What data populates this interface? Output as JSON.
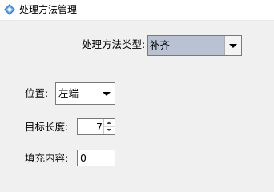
{
  "window": {
    "title": "处理方法管理",
    "icon": "diamond-app-icon"
  },
  "form": {
    "method_type": {
      "label": "处理方法类型:",
      "value": "补齐"
    },
    "position": {
      "label": "位置:",
      "value": "左端"
    },
    "target_length": {
      "label": "目标长度:",
      "value": "7"
    },
    "fill_content": {
      "label": "填充内容:",
      "value": "0"
    }
  },
  "colors": {
    "selected_combo_bg": "#b8c2d2",
    "window_bg": "#f0f0f0",
    "icon_blue": "#3c7fd6"
  }
}
